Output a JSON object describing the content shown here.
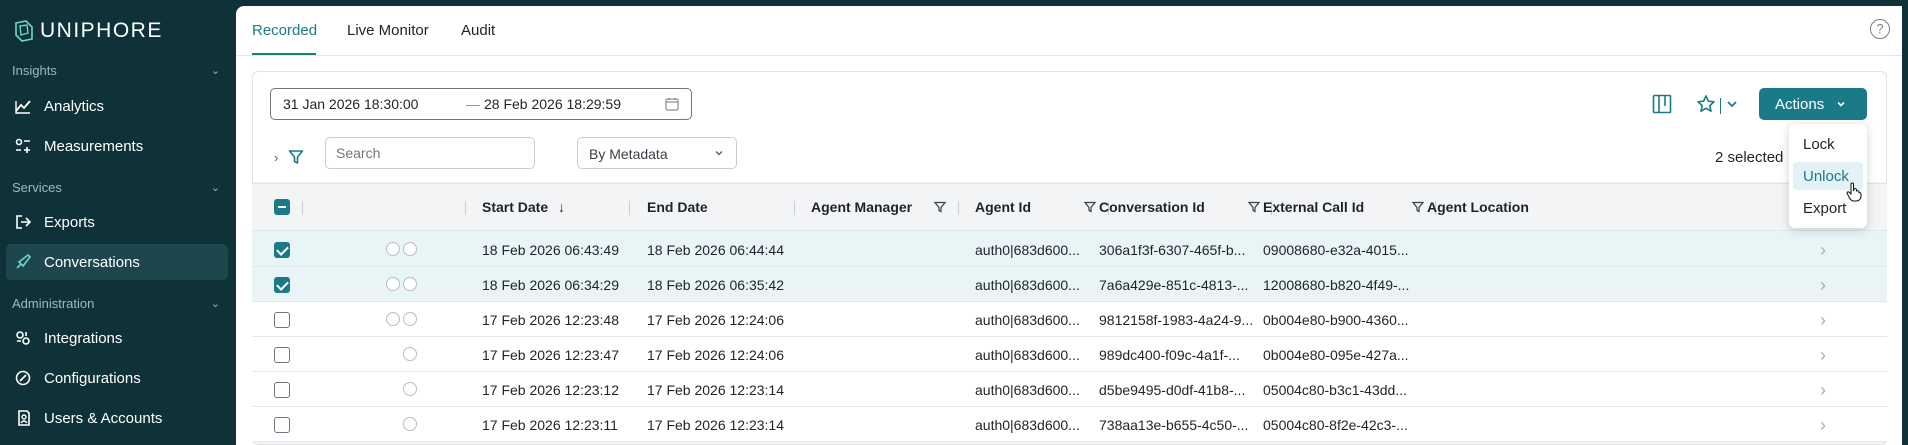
{
  "app": {
    "brand": "UNIPHORE"
  },
  "sidebar": {
    "sections": [
      {
        "label": "Insights"
      },
      {
        "label": "Services"
      },
      {
        "label": "Administration"
      }
    ],
    "items": [
      {
        "label": "Analytics",
        "icon": "analytics-icon"
      },
      {
        "label": "Measurements",
        "icon": "measurements-icon"
      },
      {
        "label": "Exports",
        "icon": "exports-icon"
      },
      {
        "label": "Conversations",
        "icon": "conversations-icon",
        "active": true
      },
      {
        "label": "Integrations",
        "icon": "integrations-icon"
      },
      {
        "label": "Configurations",
        "icon": "configurations-icon"
      },
      {
        "label": "Users & Accounts",
        "icon": "users-icon"
      }
    ]
  },
  "tabs": [
    {
      "label": "Recorded",
      "active": true
    },
    {
      "label": "Live Monitor"
    },
    {
      "label": "Audit"
    }
  ],
  "toolbar": {
    "date_from": "31 Jan 2026 18:30:00",
    "date_to": "28 Feb 2026 18:29:59",
    "actions_label": "Actions",
    "search_placeholder": "Search",
    "metadata_label": "By Metadata",
    "selected_count": "2 selected"
  },
  "dropdown": {
    "items": [
      {
        "label": "Lock"
      },
      {
        "label": "Unlock",
        "hover": true
      },
      {
        "label": "Export"
      }
    ]
  },
  "table": {
    "columns": [
      {
        "label": "Start Date",
        "sort": "desc"
      },
      {
        "label": "End Date"
      },
      {
        "label": "Agent Manager",
        "filter": true
      },
      {
        "label": "Agent Id",
        "filter": true
      },
      {
        "label": "Conversation Id",
        "filter": true
      },
      {
        "label": "External Call Id",
        "filter": true
      },
      {
        "label": "Agent Location",
        "filter": true
      }
    ],
    "rows": [
      {
        "selected": true,
        "icons": [
          "lock-icon",
          "note-icon"
        ],
        "start": "18 Feb 2026 06:43:49",
        "end": "18 Feb 2026 06:44:44",
        "manager": "",
        "agent": "auth0|683d600...",
        "conversation": "306a1f3f-6307-465f-b...",
        "external": "09008680-e32a-4015..."
      },
      {
        "selected": true,
        "icons": [
          "lock-icon",
          "note-icon"
        ],
        "start": "18 Feb 2026 06:34:29",
        "end": "18 Feb 2026 06:35:42",
        "manager": "",
        "agent": "auth0|683d600...",
        "conversation": "7a6a429e-851c-4813-...",
        "external": "12008680-b820-4f49-..."
      },
      {
        "selected": false,
        "icons": [
          "lock-icon",
          "note-icon"
        ],
        "start": "17 Feb 2026 12:23:48",
        "end": "17 Feb 2026 12:24:06",
        "manager": "",
        "agent": "auth0|683d600...",
        "conversation": "9812158f-1983-4a24-9...",
        "external": "0b004e80-b900-4360..."
      },
      {
        "selected": false,
        "icons": [
          "note-icon"
        ],
        "start": "17 Feb 2026 12:23:47",
        "end": "17 Feb 2026 12:24:06",
        "manager": "",
        "agent": "auth0|683d600...",
        "conversation": "989dc400-f09c-4a1f-...",
        "external": "0b004e80-095e-427a..."
      },
      {
        "selected": false,
        "icons": [
          "note-icon"
        ],
        "start": "17 Feb 2026 12:23:12",
        "end": "17 Feb 2026 12:23:14",
        "manager": "",
        "agent": "auth0|683d600...",
        "conversation": "d5be9495-d0df-41b8-...",
        "external": "05004c80-b3c1-43dd..."
      },
      {
        "selected": false,
        "icons": [
          "note-icon"
        ],
        "start": "17 Feb 2026 12:23:11",
        "end": "17 Feb 2026 12:23:14",
        "manager": "",
        "agent": "auth0|683d600...",
        "conversation": "738aa13e-b655-4c50-...",
        "external": "05004c80-8f2e-42c3-..."
      }
    ]
  },
  "colors": {
    "sidebar_bg": "#0f3238",
    "accent": "#1b7a87",
    "active_nav": "#1d474d"
  }
}
